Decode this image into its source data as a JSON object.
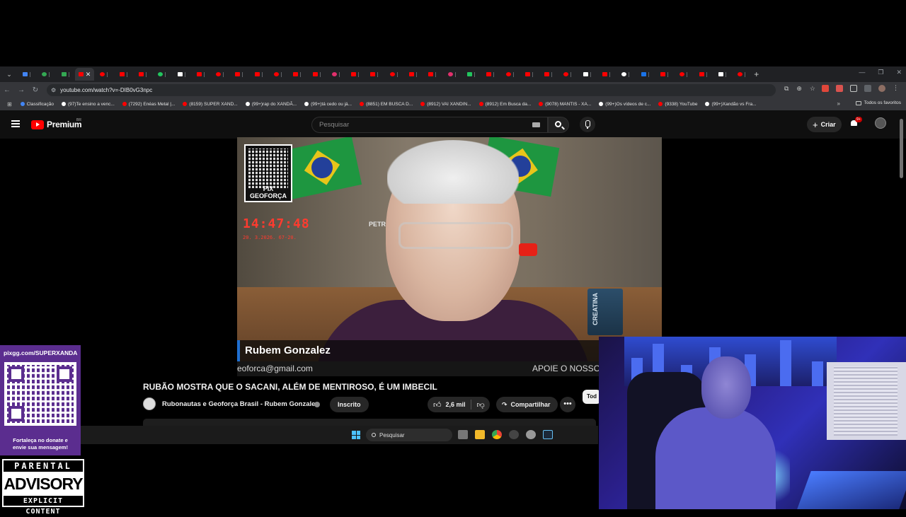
{
  "browser": {
    "url": "youtube.com/watch?v=-DIB0vG3npc",
    "tabs_count": 38,
    "new_tab": "+",
    "bookmarks": [
      {
        "label": "Classificação",
        "color": "#4285f4"
      },
      {
        "label": "(97)Te ensino a venc...",
        "color": "#ffffff"
      },
      {
        "label": "(7292) Enéas Metal |...",
        "color": "#ff0000"
      },
      {
        "label": "(8159) SUPER XAND...",
        "color": "#ff0000"
      },
      {
        "label": "(99+)rap do XANDÃ...",
        "color": "#ffffff"
      },
      {
        "label": "(99+)tá cedo ou já...",
        "color": "#ffffff"
      },
      {
        "label": "(8851) EM BUSCA D...",
        "color": "#ff0000"
      },
      {
        "label": "(8912) VAI XANDIN...",
        "color": "#ff0000"
      },
      {
        "label": "(8912) Em Busca da...",
        "color": "#ff0000"
      },
      {
        "label": "(9078) MANTIS - XA...",
        "color": "#ff0000"
      },
      {
        "label": "(99+)Os vídeos de c...",
        "color": "#ffffff"
      },
      {
        "label": "(9338) YouTube",
        "color": "#ff0000"
      },
      {
        "label": "(99+)Xandão vs Fra...",
        "color": "#ffffff"
      }
    ],
    "bookmarks_more": "»",
    "all_bookmarks": "Todos os favoritos"
  },
  "youtube": {
    "logo_text": "Premium",
    "country": "BR",
    "search_placeholder": "Pesquisar",
    "create_label": "Criar",
    "notif_badge": "9+",
    "video": {
      "qr_label": "PIX GEOFORÇA",
      "clock_time": "14:47:48",
      "clock_date": "20. 3.2026.   67-20.",
      "can_text": "CREATINA",
      "shelf_text": "PETROL",
      "name_overlay": "Rubem Gonzalez",
      "email_ticker": "eoforca@gmail.com",
      "support_ticker": "APOIE O NOSSO"
    },
    "title": "RUBÃO MOSTRA QUE O SACANI, ALÉM DE MENTIROSO, É UM IMBECIL",
    "channel": "Rubonautas e Geoforça Brasil - Rubem Gonzalez",
    "subscribed_label": "Inscrito",
    "likes": "2,6 mil",
    "share_label": "Compartilhar",
    "more_label": "•••",
    "chip_label": "Tod"
  },
  "taskbar": {
    "search_placeholder": "Pesquisar"
  },
  "overlay": {
    "pix_url": "pixgg.com/SUPERXANDA",
    "donate_message_line1": "Fortaleça no donate e",
    "donate_message_line2": "envie sua mensagem!",
    "advisory_top": "PARENTAL",
    "advisory_mid": "ADVISORY",
    "advisory_bottom": "EXPLICIT CONTENT"
  }
}
